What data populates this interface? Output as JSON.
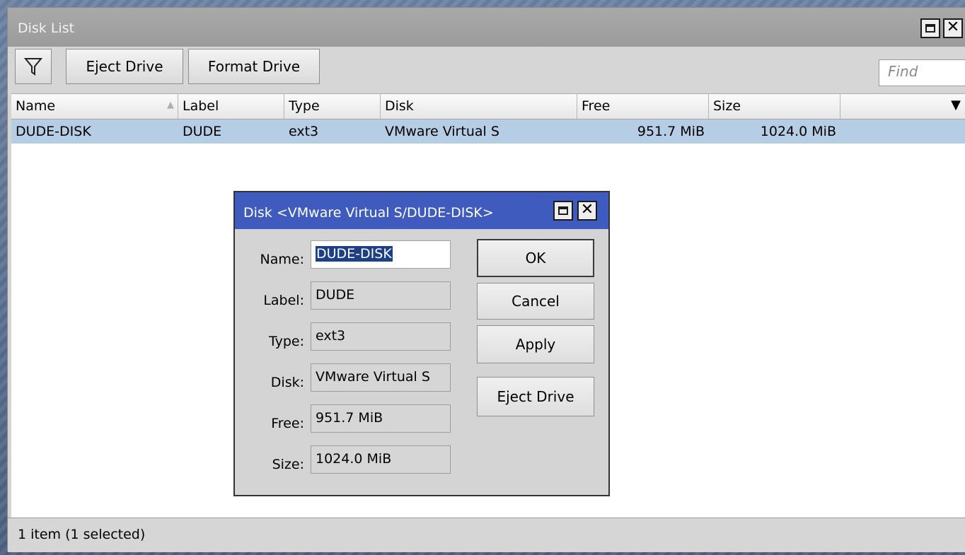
{
  "window": {
    "title": "Disk List",
    "toolbar": {
      "eject_label": "Eject Drive",
      "format_label": "Format Drive",
      "find_placeholder": "Find"
    },
    "columns": [
      "Name",
      "Label",
      "Type",
      "Disk",
      "Free",
      "Size"
    ],
    "rows": [
      {
        "name": "DUDE-DISK",
        "label": "DUDE",
        "type": "ext3",
        "disk": "VMware Virtual S",
        "free": "951.7 MiB",
        "size": "1024.0 MiB",
        "selected": true
      }
    ],
    "status": "1 item (1 selected)"
  },
  "dialog": {
    "title": "Disk <VMware Virtual S/DUDE-DISK>",
    "fields": {
      "name_label": "Name:",
      "name_value": "DUDE-DISK",
      "label_label": "Label:",
      "label_value": "DUDE",
      "type_label": "Type:",
      "type_value": "ext3",
      "disk_label": "Disk:",
      "disk_value": "VMware Virtual S",
      "free_label": "Free:",
      "free_value": "951.7 MiB",
      "size_label": "Size:",
      "size_value": "1024.0 MiB"
    },
    "buttons": {
      "ok": "OK",
      "cancel": "Cancel",
      "apply": "Apply",
      "eject": "Eject Drive"
    }
  },
  "colors": {
    "selection_row": "#b6cde6",
    "dialog_titlebar": "#3e5bbd",
    "text_selection": "#1c3f86"
  }
}
